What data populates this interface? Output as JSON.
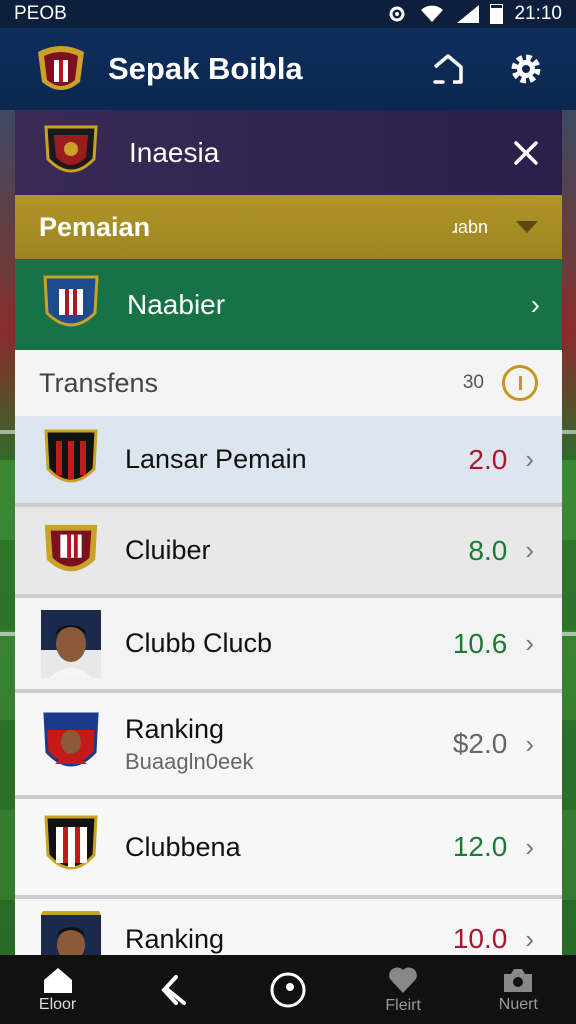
{
  "status": {
    "left_text": "PEOB",
    "time": "21:10"
  },
  "appbar": {
    "title": "Sepak Boibla"
  },
  "team": {
    "name": "Inaesia"
  },
  "category": {
    "title": "Pemaian",
    "sort_label": "ɹabn"
  },
  "league": {
    "name": "Naabier"
  },
  "section": {
    "title": "Transfens",
    "count": "30"
  },
  "items": [
    {
      "title": "Lansar Pemain",
      "subtitle": "",
      "value": "2.0",
      "value_color": "#b0122a"
    },
    {
      "title": "Cluiber",
      "subtitle": "",
      "value": "8.0",
      "value_color": "#1d7a35"
    },
    {
      "title": "Clubb Clucb",
      "subtitle": "",
      "value": "10.6",
      "value_color": "#1d7a35"
    },
    {
      "title": "Ranking",
      "subtitle": "Buaagln0eek",
      "value": "$2.0",
      "value_color": "#666666"
    },
    {
      "title": "Clubbena",
      "subtitle": "",
      "value": "12.0",
      "value_color": "#1d7a35"
    },
    {
      "title": "Ranking",
      "subtitle": "",
      "value": "10.0",
      "value_color": "#b0122a"
    }
  ],
  "nav": [
    {
      "label": "Eloor",
      "icon": "home-icon"
    },
    {
      "label": "",
      "icon": "back-arrow-icon"
    },
    {
      "label": "",
      "icon": "record-icon"
    },
    {
      "label": "Fleirt",
      "icon": "heart-icon"
    },
    {
      "label": "Nuert",
      "icon": "camera-icon"
    }
  ]
}
